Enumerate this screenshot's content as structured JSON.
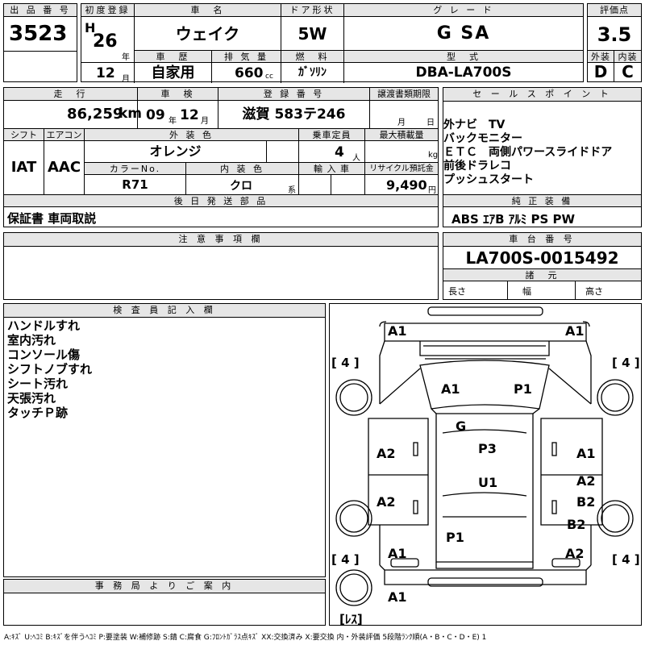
{
  "header": {
    "lot_label": "出 品 番 号",
    "lot_number": "3523",
    "first_reg_label": "初度登録",
    "era": "H",
    "year": "26",
    "year_unit": "年",
    "month": "12",
    "month_unit": "月",
    "car_name_label": "車　名",
    "car_name": "ウェイク",
    "door_label": "ドア形状",
    "door": "5W",
    "grade_label": "グ レ ー ド",
    "grade": "G SA",
    "score_label": "評価点",
    "score": "3.5",
    "history_label": "車　歴",
    "history": "自家用",
    "displacement_label": "排 気 量",
    "displacement": "660",
    "displacement_unit": "cc",
    "fuel_label": "燃　料",
    "fuel": "ｶﾞｿﾘﾝ",
    "model_label": "型　式",
    "model": "DBA-LA700S",
    "exterior_label": "外装",
    "exterior": "D",
    "interior_label": "内装",
    "interior": "C"
  },
  "row2": {
    "mileage_label": "走　行",
    "mileage": "86,259",
    "mileage_unit": "km",
    "inspection_label": "車　検",
    "inspection_year": "09",
    "inspection_year_unit": "年",
    "inspection_month": "12",
    "inspection_month_unit": "月",
    "registration_label": "登 録 番 号",
    "registration": "滋賀 583テ246",
    "transfer_label": "譲渡書類期限",
    "transfer_month_unit": "月",
    "transfer_day_unit": "日"
  },
  "row3": {
    "shift_label": "シフト",
    "shift": "IAT",
    "aircon_label": "エアコン",
    "aircon": "AAC",
    "body_color_label": "外 装 色",
    "body_color": "オレンジ",
    "capacity_label": "乗車定員",
    "capacity": "4",
    "capacity_unit": "人",
    "max_load_label": "最大積載量",
    "max_load_unit": "kg",
    "color_no_label": "カラーNo.",
    "color_no": "R71",
    "int_color_label": "内 装 色",
    "int_color": "クロ",
    "int_color_unit": "系",
    "import_label": "輸 入 車",
    "recycle_label": "リサイクル預託金",
    "recycle": "9,490",
    "recycle_unit": "円"
  },
  "later_parts": {
    "label": "後 日 発 送 部 品",
    "text": "保証書 車両取説"
  },
  "sales_points": {
    "label": "セ ー ル ス ポ イ ン ト",
    "text": "外ナビ　TV\nバックモニター\nＥＴＣ　両側パワースライドドア\n前後ドラレコ\nプッシュスタート"
  },
  "equipment": {
    "label": "純 正 装 備",
    "text": "ABS ｴｱB ｱﾙﾐ PS PW"
  },
  "notes": {
    "label": "注 意 事 項 欄",
    "text": ""
  },
  "chassis": {
    "label": "車 台 番 号",
    "number": "LA700S-0015492",
    "dims_label": "諸　元",
    "length_label": "長さ",
    "width_label": "幅",
    "height_label": "高さ"
  },
  "inspector": {
    "label": "検 査 員 記 入 欄",
    "text": "ハンドルすれ\n室内汚れ\nコンソール傷\nシフトノブすれ\nシート汚れ\n天張汚れ\nタッチＰ跡"
  },
  "office": {
    "label": "事 務 局 よ り ご 案 内",
    "text": ""
  },
  "diagram": {
    "marks": [
      {
        "id": "front-left-bumper",
        "text": "A1"
      },
      {
        "id": "front-right-bumper",
        "text": "A1"
      },
      {
        "id": "tire-fl",
        "text": "[ 4 ]"
      },
      {
        "id": "tire-fr",
        "text": "[ 4 ]"
      },
      {
        "id": "windshield-left",
        "text": "A1"
      },
      {
        "id": "windshield-right",
        "text": "P1"
      },
      {
        "id": "roof-front",
        "text": "G"
      },
      {
        "id": "left-front-door",
        "text": "A2"
      },
      {
        "id": "roof-center",
        "text": "P3"
      },
      {
        "id": "right-front-door",
        "text": "A1"
      },
      {
        "id": "roof-rear",
        "text": "U1"
      },
      {
        "id": "right-rear-door-a",
        "text": "A2"
      },
      {
        "id": "left-rear-door",
        "text": "A2"
      },
      {
        "id": "right-rear-door-b",
        "text": "B2"
      },
      {
        "id": "right-rear-quarter",
        "text": "B2"
      },
      {
        "id": "rear-glass",
        "text": "P1"
      },
      {
        "id": "left-rear-quarter",
        "text": "A1"
      },
      {
        "id": "right-rear-corner",
        "text": "A2"
      },
      {
        "id": "tire-rl",
        "text": "[ 4 ]"
      },
      {
        "id": "tire-rr",
        "text": "[ 4 ]"
      },
      {
        "id": "rear-bumper",
        "text": "A1"
      },
      {
        "id": "spare",
        "text": "[ﾚｽ]"
      }
    ]
  },
  "legend": "A:ｷｽﾞ U:ﾍｺﾐ B:ｷｽﾞを伴うﾍｺﾐ P:要塗装 W:補修跡 S:錆 C:腐食 G:ﾌﾛﾝﾄｶﾞﾗｽ点ｷｽﾞ XX:交換済み X:要交換 内・外装評価 5段階ﾗﾝｸ順(A・B・C・D・E) 1"
}
